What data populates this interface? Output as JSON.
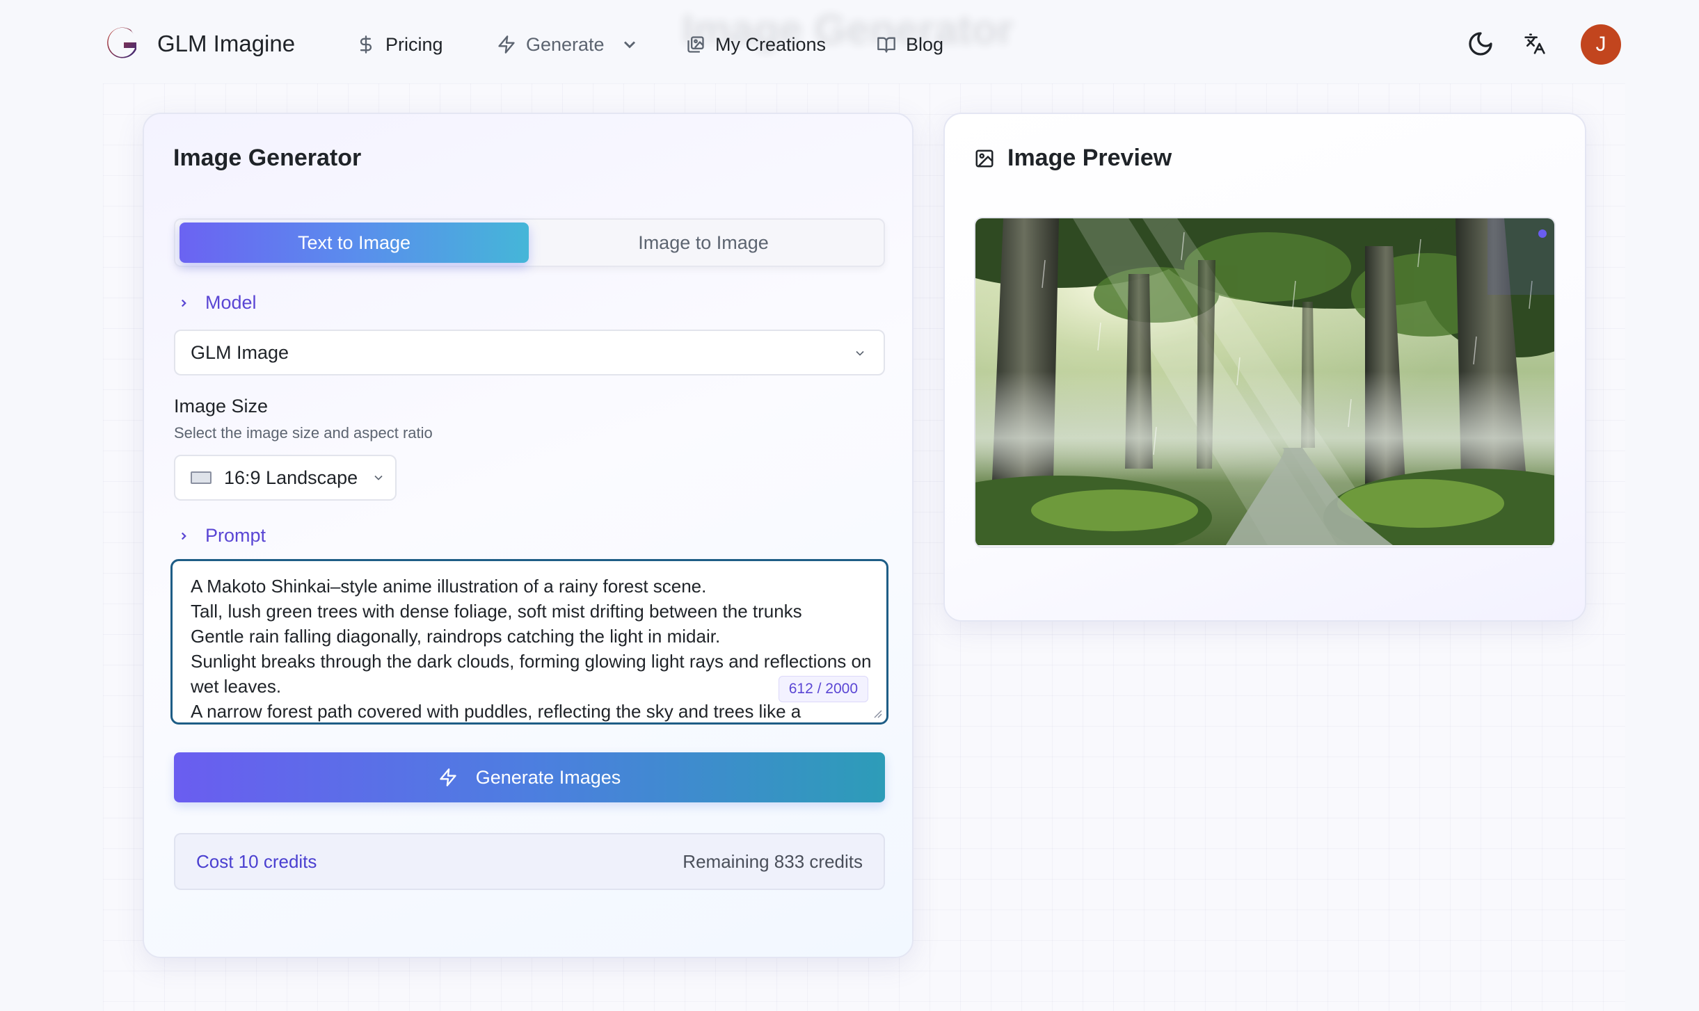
{
  "app": {
    "brand_name": "GLM Imagine",
    "background_heading": "Image Generator"
  },
  "nav": {
    "pricing": "Pricing",
    "generate": "Generate",
    "my_creations": "My Creations",
    "blog": "Blog"
  },
  "user": {
    "avatar_initial": "J",
    "avatar_color": "#c2451e"
  },
  "generator": {
    "title": "Image Generator",
    "tabs": [
      {
        "label": "Text to Image",
        "active": true
      },
      {
        "label": "Image to Image",
        "active": false
      }
    ],
    "model": {
      "section_label": "Model",
      "selected": "GLM Image"
    },
    "image_size": {
      "label": "Image Size",
      "help": "Select the image size and aspect ratio",
      "selected": "16:9 Landscape"
    },
    "prompt": {
      "section_label": "Prompt",
      "value": "A Makoto Shinkai–style anime illustration of a rainy forest scene.\nTall, lush green trees with dense foliage, soft mist drifting between the trunks\nGentle rain falling diagonally, raindrops catching the light in midair.\nSunlight breaks through the dark clouds, forming glowing light rays and reflections on wet leaves.\nA narrow forest path covered with puddles, reflecting the sky and trees like a",
      "counter": "612 / 2000"
    },
    "generate_button": "Generate Images",
    "credits": {
      "cost": "Cost 10 credits",
      "remaining": "Remaining 833 credits"
    }
  },
  "preview": {
    "title": "Image Preview"
  },
  "colors": {
    "accent": "#5a46d4",
    "tab_gradient_start": "#6b63f2",
    "tab_gradient_end": "#45b6d8",
    "prompt_border": "#1e5d86"
  },
  "icons": {
    "logo": "glm-g-logo",
    "pricing": "dollar-icon",
    "generate": "lightning-icon",
    "my_creations": "images-icon",
    "blog": "book-icon",
    "theme": "moon-icon",
    "language": "translate-icon",
    "preview": "image-icon"
  }
}
